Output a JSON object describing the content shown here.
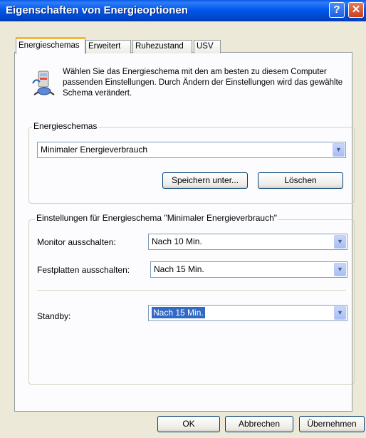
{
  "window": {
    "title": "Eigenschaften von Energieoptionen",
    "help_glyph": "?",
    "close_glyph": "✕"
  },
  "tabs": [
    {
      "label": "Energieschemas",
      "active": true
    },
    {
      "label": "Erweitert",
      "active": false
    },
    {
      "label": "Ruhezustand",
      "active": false
    },
    {
      "label": "USV",
      "active": false
    }
  ],
  "description": {
    "icon": "power-scheme-icon",
    "text": "Wählen Sie das Energieschema mit den am besten zu diesem Computer passenden Einstellungen. Durch Ändern der Einstellungen wird das gewählte Schema verändert."
  },
  "schemes_group": {
    "label": "Energieschemas",
    "selected": "Minimaler Energieverbrauch",
    "save_as_label": "Speichern unter...",
    "delete_label": "Löschen"
  },
  "settings_group": {
    "label": "Einstellungen für Energieschema \"Minimaler Energieverbrauch\"",
    "monitor_label": "Monitor ausschalten:",
    "monitor_value": "Nach 10 Min.",
    "disks_label": "Festplatten ausschalten:",
    "disks_value": "Nach 15 Min.",
    "standby_label": "Standby:",
    "standby_value": "Nach 15 Min."
  },
  "buttons": {
    "ok": "OK",
    "cancel": "Abbrechen",
    "apply": "Übernehmen"
  },
  "colors": {
    "titlebar": "#0058ee",
    "selection": "#316ac5",
    "tab_highlight": "#f5b53f"
  }
}
